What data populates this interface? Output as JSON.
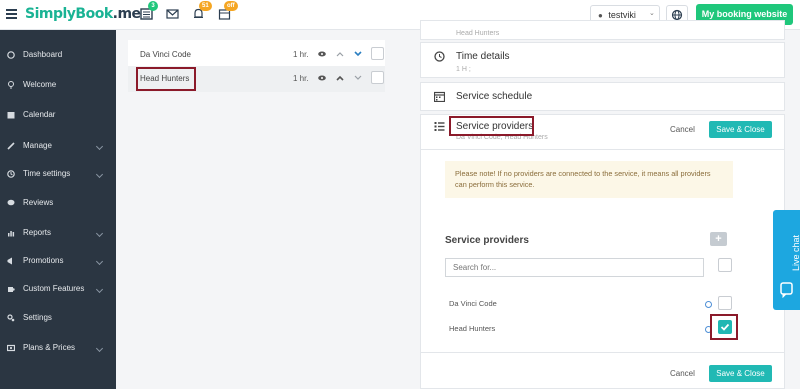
{
  "header": {
    "logo": "SimplyBook",
    "logo_suffix": ".me",
    "badges": {
      "list": "3",
      "bell": "51",
      "calendar": "off"
    },
    "user": "testviki",
    "cta": "My booking website"
  },
  "sidebar": {
    "items": [
      {
        "label": "Dashboard"
      },
      {
        "label": "Welcome"
      },
      {
        "label": "Calendar"
      },
      {
        "label": "Manage"
      },
      {
        "label": "Time settings"
      },
      {
        "label": "Reviews"
      },
      {
        "label": "Reports"
      },
      {
        "label": "Promotions"
      },
      {
        "label": "Custom Features"
      },
      {
        "label": "Settings"
      },
      {
        "label": "Plans & Prices"
      }
    ]
  },
  "list": {
    "rows": [
      {
        "name": "Da Vinci Code",
        "duration": "1 hr."
      },
      {
        "name": "Head Hunters",
        "duration": "1 hr."
      }
    ]
  },
  "panel": {
    "truncated_top": "Head Hunters",
    "time_details": {
      "title": "Time details",
      "sub": "1 H ;"
    },
    "schedule": {
      "title": "Service schedule"
    },
    "providers": {
      "title": "Service providers",
      "sub": "Da Vinci Code, Head Hunters",
      "cancel": "Cancel",
      "save": "Save & Close",
      "note": "Please note! If no providers are connected to the service, it means all providers can perform this service.",
      "heading": "Service providers",
      "add": "+",
      "search_placeholder": "Search for...",
      "items": [
        {
          "name": "Da Vinci Code",
          "checked": false
        },
        {
          "name": "Head Hunters",
          "checked": true
        }
      ]
    }
  },
  "livechat": "Live chat",
  "colors": {
    "brand": "#1ab394",
    "cta": "#1fc77b",
    "accent": "#21b9b4",
    "sidebar": "#2b3642",
    "highlight": "#8b1a2a"
  }
}
